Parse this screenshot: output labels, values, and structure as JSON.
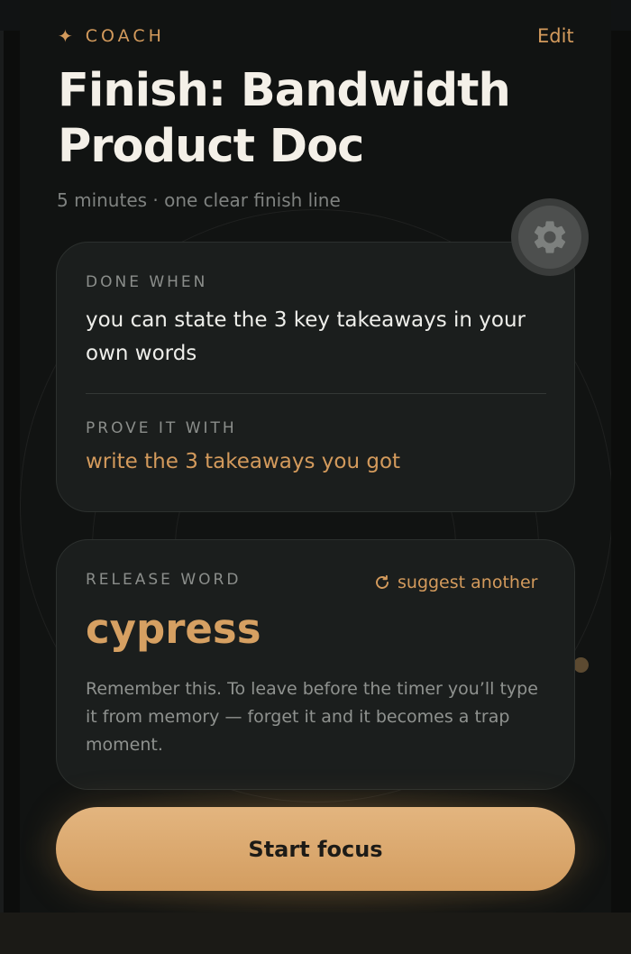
{
  "header": {
    "eyebrow": "COACH",
    "edit_label": "Edit",
    "title": "Finish: Bandwidth Product Doc",
    "subtitle": "5 minutes · one clear finish line"
  },
  "done_card": {
    "done_when_label": "DONE WHEN",
    "done_when_text": "you can state the 3 key takeaways in your own words",
    "prove_label": "PROVE IT WITH",
    "prove_text": "write the 3 takeaways you got"
  },
  "release_card": {
    "label": "RELEASE WORD",
    "suggest_label": "suggest another",
    "word": "cypress",
    "description": "Remember this. To leave before the timer you’ll type it from memory — forget it and it becomes a trap moment."
  },
  "primary_action": {
    "label": "Start focus"
  },
  "icons": {
    "eyebrow": "sparkle-icon",
    "settings": "gear-icon",
    "suggest": "refresh-icon"
  },
  "colors": {
    "accent": "#d39a5c",
    "background": "#111312",
    "card": "#1b1e1d",
    "button": "#dfae74"
  }
}
